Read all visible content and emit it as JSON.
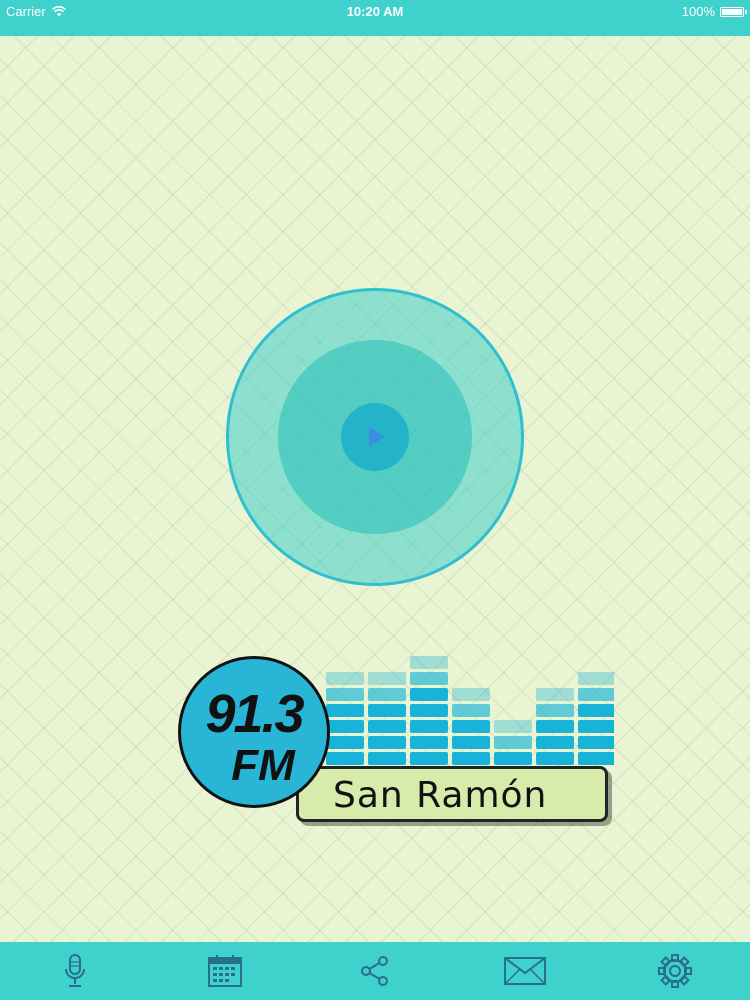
{
  "status_bar": {
    "carrier": "Carrier",
    "time": "10:20 AM",
    "battery": "100%",
    "battery_level": 1.0
  },
  "logo": {
    "frequency": "91.3",
    "band": "FM",
    "station_name": "San Ramón"
  },
  "colors": {
    "accent": "#3fd2cc",
    "background": "#e9f5d2",
    "play_button": "#24b4ca",
    "logo_circle": "#29b6d6",
    "equalizer": "#19b2d8"
  },
  "tab_bar": {
    "items": [
      {
        "icon": "microphone-icon"
      },
      {
        "icon": "calendar-icon"
      },
      {
        "icon": "share-icon"
      },
      {
        "icon": "mail-icon"
      },
      {
        "icon": "gear-icon"
      }
    ]
  }
}
